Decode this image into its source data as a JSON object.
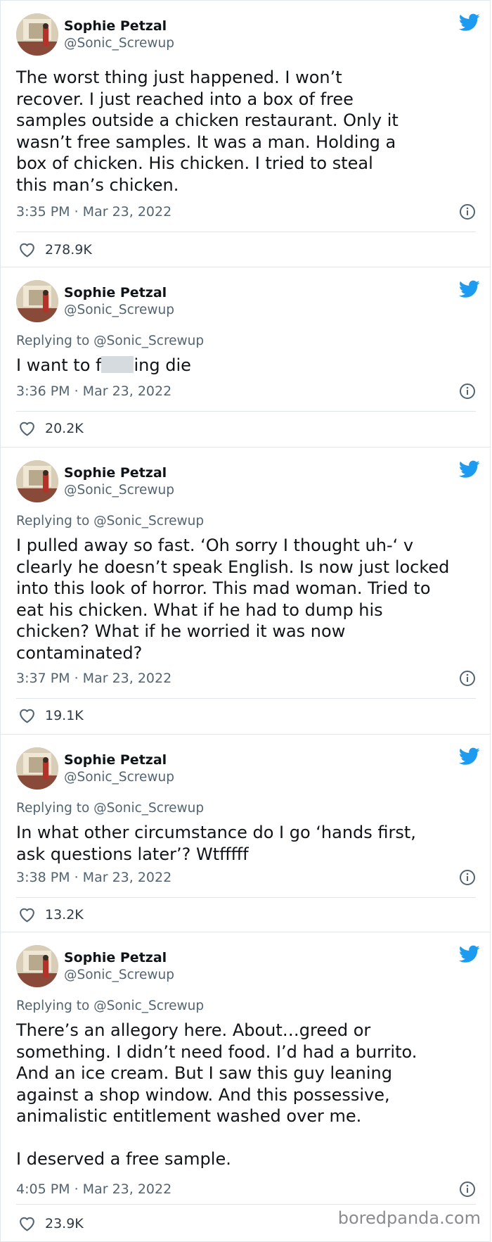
{
  "colors": {
    "bird": "#1d9bf0",
    "text": "#0f1419",
    "secondary": "#536471",
    "divider": "#dfe5e9"
  },
  "author": {
    "display_name": "Sophie Petzal",
    "handle": "@Sonic_Screwup"
  },
  "tweets": [
    {
      "replying_to": "",
      "text": "The worst thing just happened. I won’t\nrecover. I just reached into a box of free\nsamples outside a chicken restaurant. Only it\nwasn’t free samples. It was a man. Holding a\nbox of chicken. His chicken. I tried to steal\nthis man’s chicken.",
      "timestamp": "3:35 PM · Mar 23, 2022",
      "likes": "278.9K"
    },
    {
      "replying_to": "Replying to @Sonic_Screwup",
      "text_before": "I want to f",
      "text_after": "ing die",
      "timestamp": "3:36 PM · Mar 23, 2022",
      "likes": "20.2K"
    },
    {
      "replying_to": "Replying to @Sonic_Screwup",
      "text": "I pulled away so fast. ‘Oh sorry I thought uh-‘ v\nclearly he doesn’t speak English. Is now just locked\ninto this look of horror. This mad woman. Tried to\neat his chicken. What if he had to dump his\nchicken? What if he worried it was now\ncontaminated?",
      "timestamp": "3:37 PM · Mar 23, 2022",
      "likes": "19.1K"
    },
    {
      "replying_to": "Replying to @Sonic_Screwup",
      "text": "In what other circumstance do I go ‘hands first,\nask questions later’? Wtfffff",
      "timestamp": "3:38 PM · Mar 23, 2022",
      "likes": "13.2K"
    },
    {
      "replying_to": "Replying to @Sonic_Screwup",
      "text": "There’s an allegory here. About…greed or\nsomething. I didn’t need food. I’d had a burrito.\nAnd an ice cream. But I saw this guy leaning\nagainst a shop window. And this possessive,\nanimalistic entitlement washed over me.\n\nI deserved a free sample.",
      "timestamp": "4:05 PM · Mar 23, 2022",
      "likes": "23.9K"
    }
  ],
  "watermark": "boredpanda.com"
}
